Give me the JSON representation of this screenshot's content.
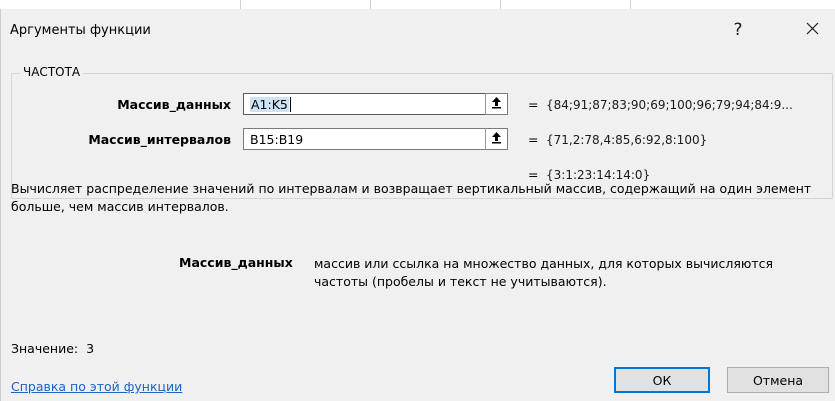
{
  "dialog": {
    "title": "Аргументы функции",
    "help_glyph": "?",
    "close_glyph": "✕"
  },
  "function": {
    "name": "ЧАСТОТА",
    "args": [
      {
        "label": "Массив_данных",
        "value": "A1:K5",
        "evaluated": "{84;91;87;83;90;69;100;96;79;94;84:9..."
      },
      {
        "label": "Массив_интервалов",
        "value": "B15:B19",
        "evaluated": "{71,2:78,4:85,6:92,8:100}"
      }
    ],
    "equals_sign": "=",
    "result": "{3:1:23:14:14:0}",
    "description": "Вычисляет распределение значений по интервалам и возвращает вертикальный массив, содержащий на один элемент больше, чем массив интервалов.",
    "arg_help_label": "Массив_данных",
    "arg_help_text": "массив или ссылка на множество данных, для которых вычисляются частоты (пробелы и текст не учитываются)."
  },
  "footer": {
    "value_label": "Значение:",
    "value": "3",
    "help_link": "Справка по этой функции",
    "ok_label": "ОК",
    "cancel_label": "Отмена"
  },
  "colors": {
    "dialog_bg": "#f0f0f0",
    "link": "#1a63c4",
    "default_button_border": "#0078d7",
    "selection": "#cfe3f7"
  }
}
